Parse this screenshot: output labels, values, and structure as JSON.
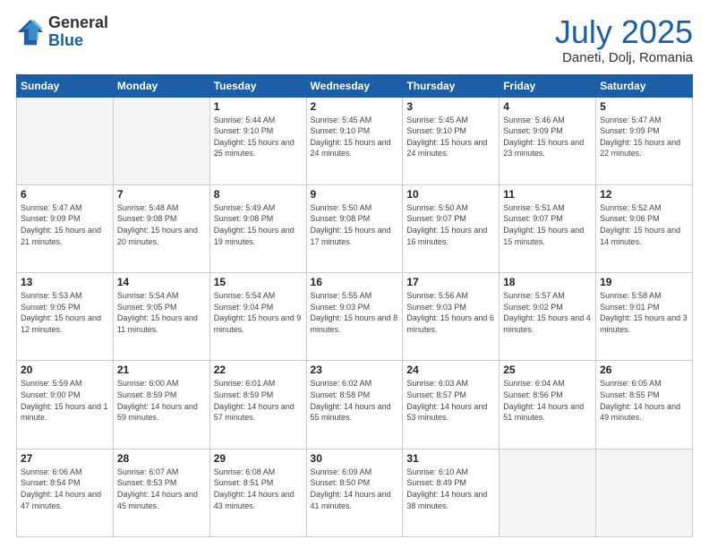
{
  "header": {
    "logo_general": "General",
    "logo_blue": "Blue",
    "month_year": "July 2025",
    "location": "Daneti, Dolj, Romania"
  },
  "weekdays": [
    "Sunday",
    "Monday",
    "Tuesday",
    "Wednesday",
    "Thursday",
    "Friday",
    "Saturday"
  ],
  "weeks": [
    [
      {
        "day": "",
        "sunrise": "",
        "sunset": "",
        "daylight": ""
      },
      {
        "day": "",
        "sunrise": "",
        "sunset": "",
        "daylight": ""
      },
      {
        "day": "1",
        "sunrise": "Sunrise: 5:44 AM",
        "sunset": "Sunset: 9:10 PM",
        "daylight": "Daylight: 15 hours and 25 minutes."
      },
      {
        "day": "2",
        "sunrise": "Sunrise: 5:45 AM",
        "sunset": "Sunset: 9:10 PM",
        "daylight": "Daylight: 15 hours and 24 minutes."
      },
      {
        "day": "3",
        "sunrise": "Sunrise: 5:45 AM",
        "sunset": "Sunset: 9:10 PM",
        "daylight": "Daylight: 15 hours and 24 minutes."
      },
      {
        "day": "4",
        "sunrise": "Sunrise: 5:46 AM",
        "sunset": "Sunset: 9:09 PM",
        "daylight": "Daylight: 15 hours and 23 minutes."
      },
      {
        "day": "5",
        "sunrise": "Sunrise: 5:47 AM",
        "sunset": "Sunset: 9:09 PM",
        "daylight": "Daylight: 15 hours and 22 minutes."
      }
    ],
    [
      {
        "day": "6",
        "sunrise": "Sunrise: 5:47 AM",
        "sunset": "Sunset: 9:09 PM",
        "daylight": "Daylight: 15 hours and 21 minutes."
      },
      {
        "day": "7",
        "sunrise": "Sunrise: 5:48 AM",
        "sunset": "Sunset: 9:08 PM",
        "daylight": "Daylight: 15 hours and 20 minutes."
      },
      {
        "day": "8",
        "sunrise": "Sunrise: 5:49 AM",
        "sunset": "Sunset: 9:08 PM",
        "daylight": "Daylight: 15 hours and 19 minutes."
      },
      {
        "day": "9",
        "sunrise": "Sunrise: 5:50 AM",
        "sunset": "Sunset: 9:08 PM",
        "daylight": "Daylight: 15 hours and 17 minutes."
      },
      {
        "day": "10",
        "sunrise": "Sunrise: 5:50 AM",
        "sunset": "Sunset: 9:07 PM",
        "daylight": "Daylight: 15 hours and 16 minutes."
      },
      {
        "day": "11",
        "sunrise": "Sunrise: 5:51 AM",
        "sunset": "Sunset: 9:07 PM",
        "daylight": "Daylight: 15 hours and 15 minutes."
      },
      {
        "day": "12",
        "sunrise": "Sunrise: 5:52 AM",
        "sunset": "Sunset: 9:06 PM",
        "daylight": "Daylight: 15 hours and 14 minutes."
      }
    ],
    [
      {
        "day": "13",
        "sunrise": "Sunrise: 5:53 AM",
        "sunset": "Sunset: 9:05 PM",
        "daylight": "Daylight: 15 hours and 12 minutes."
      },
      {
        "day": "14",
        "sunrise": "Sunrise: 5:54 AM",
        "sunset": "Sunset: 9:05 PM",
        "daylight": "Daylight: 15 hours and 11 minutes."
      },
      {
        "day": "15",
        "sunrise": "Sunrise: 5:54 AM",
        "sunset": "Sunset: 9:04 PM",
        "daylight": "Daylight: 15 hours and 9 minutes."
      },
      {
        "day": "16",
        "sunrise": "Sunrise: 5:55 AM",
        "sunset": "Sunset: 9:03 PM",
        "daylight": "Daylight: 15 hours and 8 minutes."
      },
      {
        "day": "17",
        "sunrise": "Sunrise: 5:56 AM",
        "sunset": "Sunset: 9:03 PM",
        "daylight": "Daylight: 15 hours and 6 minutes."
      },
      {
        "day": "18",
        "sunrise": "Sunrise: 5:57 AM",
        "sunset": "Sunset: 9:02 PM",
        "daylight": "Daylight: 15 hours and 4 minutes."
      },
      {
        "day": "19",
        "sunrise": "Sunrise: 5:58 AM",
        "sunset": "Sunset: 9:01 PM",
        "daylight": "Daylight: 15 hours and 3 minutes."
      }
    ],
    [
      {
        "day": "20",
        "sunrise": "Sunrise: 5:59 AM",
        "sunset": "Sunset: 9:00 PM",
        "daylight": "Daylight: 15 hours and 1 minute."
      },
      {
        "day": "21",
        "sunrise": "Sunrise: 6:00 AM",
        "sunset": "Sunset: 8:59 PM",
        "daylight": "Daylight: 14 hours and 59 minutes."
      },
      {
        "day": "22",
        "sunrise": "Sunrise: 6:01 AM",
        "sunset": "Sunset: 8:59 PM",
        "daylight": "Daylight: 14 hours and 57 minutes."
      },
      {
        "day": "23",
        "sunrise": "Sunrise: 6:02 AM",
        "sunset": "Sunset: 8:58 PM",
        "daylight": "Daylight: 14 hours and 55 minutes."
      },
      {
        "day": "24",
        "sunrise": "Sunrise: 6:03 AM",
        "sunset": "Sunset: 8:57 PM",
        "daylight": "Daylight: 14 hours and 53 minutes."
      },
      {
        "day": "25",
        "sunrise": "Sunrise: 6:04 AM",
        "sunset": "Sunset: 8:56 PM",
        "daylight": "Daylight: 14 hours and 51 minutes."
      },
      {
        "day": "26",
        "sunrise": "Sunrise: 6:05 AM",
        "sunset": "Sunset: 8:55 PM",
        "daylight": "Daylight: 14 hours and 49 minutes."
      }
    ],
    [
      {
        "day": "27",
        "sunrise": "Sunrise: 6:06 AM",
        "sunset": "Sunset: 8:54 PM",
        "daylight": "Daylight: 14 hours and 47 minutes."
      },
      {
        "day": "28",
        "sunrise": "Sunrise: 6:07 AM",
        "sunset": "Sunset: 8:53 PM",
        "daylight": "Daylight: 14 hours and 45 minutes."
      },
      {
        "day": "29",
        "sunrise": "Sunrise: 6:08 AM",
        "sunset": "Sunset: 8:51 PM",
        "daylight": "Daylight: 14 hours and 43 minutes."
      },
      {
        "day": "30",
        "sunrise": "Sunrise: 6:09 AM",
        "sunset": "Sunset: 8:50 PM",
        "daylight": "Daylight: 14 hours and 41 minutes."
      },
      {
        "day": "31",
        "sunrise": "Sunrise: 6:10 AM",
        "sunset": "Sunset: 8:49 PM",
        "daylight": "Daylight: 14 hours and 38 minutes."
      },
      {
        "day": "",
        "sunrise": "",
        "sunset": "",
        "daylight": ""
      },
      {
        "day": "",
        "sunrise": "",
        "sunset": "",
        "daylight": ""
      }
    ]
  ]
}
